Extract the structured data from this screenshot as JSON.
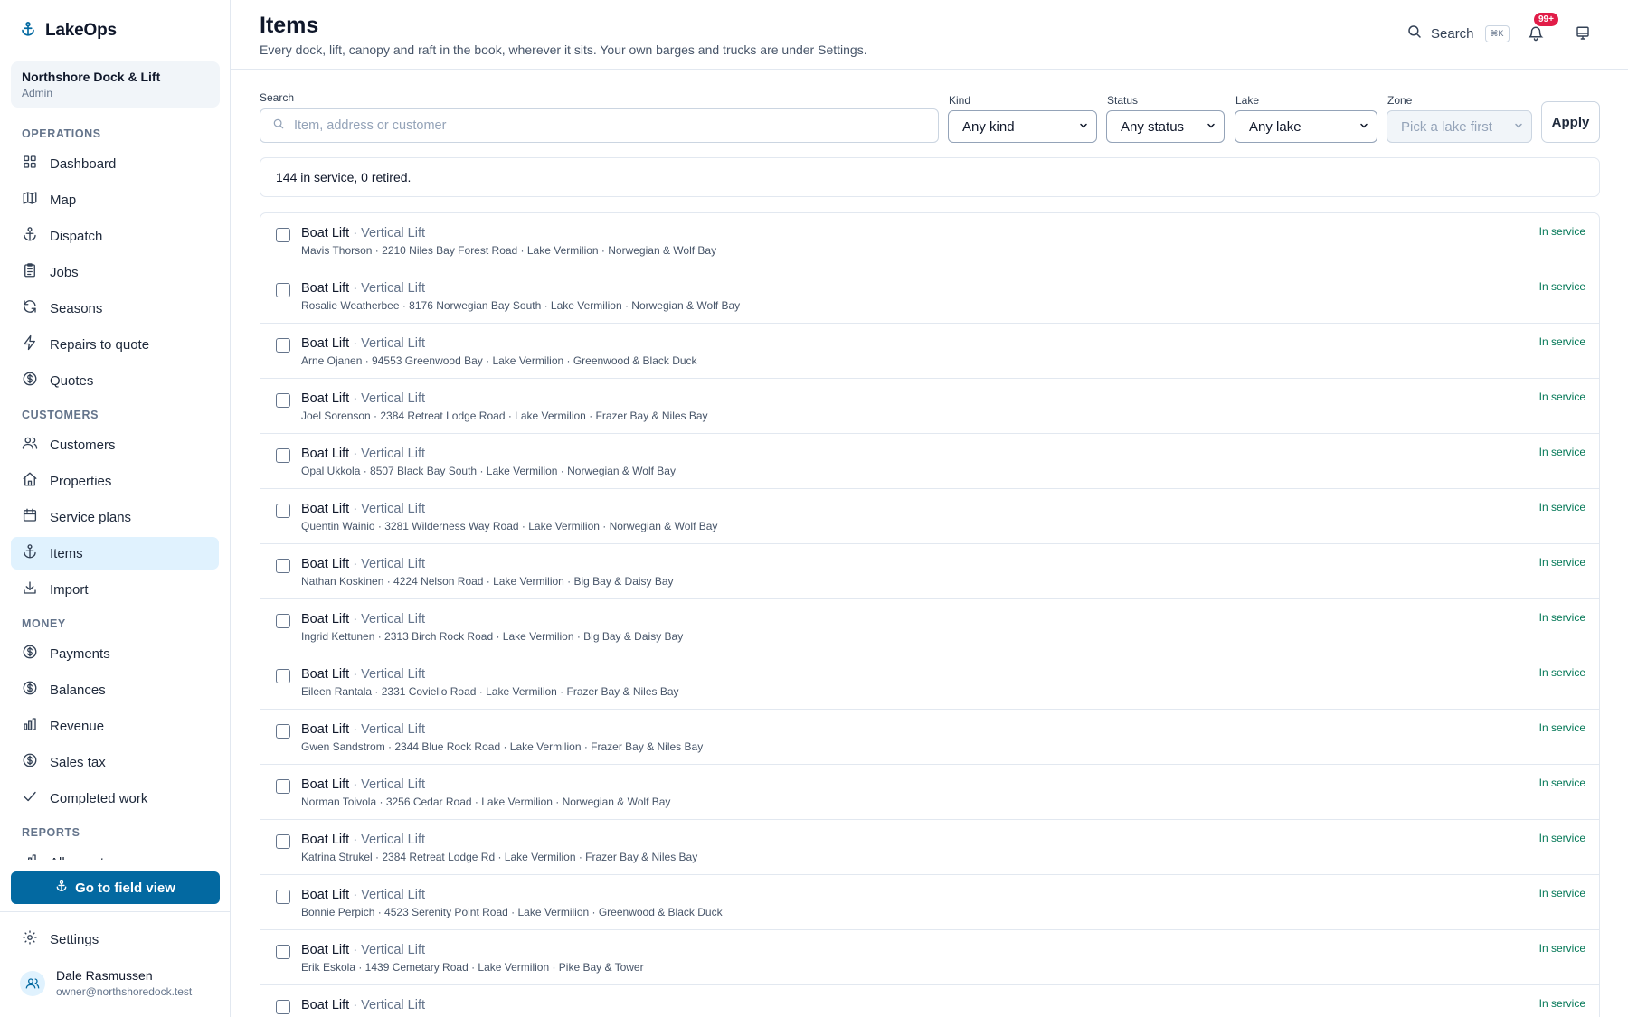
{
  "app": {
    "name": "LakeOps"
  },
  "org": {
    "name": "Northshore Dock & Lift",
    "role": "Admin"
  },
  "nav": {
    "sections": [
      {
        "label": "OPERATIONS",
        "items": [
          {
            "label": "Dashboard",
            "icon": "grid-icon"
          },
          {
            "label": "Map",
            "icon": "map-icon"
          },
          {
            "label": "Dispatch",
            "icon": "anchor-icon"
          },
          {
            "label": "Jobs",
            "icon": "clipboard-icon"
          },
          {
            "label": "Seasons",
            "icon": "refresh-icon"
          },
          {
            "label": "Repairs to quote",
            "icon": "bolt-icon"
          },
          {
            "label": "Quotes",
            "icon": "dollar-circle-icon"
          }
        ]
      },
      {
        "label": "CUSTOMERS",
        "items": [
          {
            "label": "Customers",
            "icon": "users-icon"
          },
          {
            "label": "Properties",
            "icon": "home-icon"
          },
          {
            "label": "Service plans",
            "icon": "calendar-icon"
          },
          {
            "label": "Items",
            "icon": "anchor-icon",
            "active": true
          },
          {
            "label": "Import",
            "icon": "download-icon"
          }
        ]
      },
      {
        "label": "MONEY",
        "items": [
          {
            "label": "Payments",
            "icon": "dollar-circle-icon"
          },
          {
            "label": "Balances",
            "icon": "dollar-circle-icon"
          },
          {
            "label": "Revenue",
            "icon": "bar-chart-icon"
          },
          {
            "label": "Sales tax",
            "icon": "dollar-circle-icon"
          },
          {
            "label": "Completed work",
            "icon": "check-icon"
          }
        ]
      },
      {
        "label": "REPORTS",
        "items": [
          {
            "label": "All reports",
            "icon": "bar-chart-icon"
          }
        ]
      }
    ],
    "field_view": "Go to field view",
    "settings": "Settings"
  },
  "user": {
    "name": "Dale Rasmussen",
    "email": "owner@northshoredock.test"
  },
  "header": {
    "title": "Items",
    "subtitle": "Every dock, lift, canopy and raft in the book, wherever it sits. Your own barges and trucks are under Settings.",
    "search_label": "Search",
    "search_shortcut": "⌘K",
    "notifications_badge": "99+"
  },
  "filters": {
    "search_label": "Search",
    "search_placeholder": "Item, address or customer",
    "kind_label": "Kind",
    "kind_value": "Any kind",
    "status_label": "Status",
    "status_value": "Any status",
    "lake_label": "Lake",
    "lake_value": "Any lake",
    "zone_label": "Zone",
    "zone_value": "Pick a lake first",
    "apply": "Apply"
  },
  "summary": "144 in service, 0 retired.",
  "items": [
    {
      "name": "Boat Lift",
      "kind": "Vertical Lift",
      "detail": "Mavis Thorson · 2210 Niles Bay Forest Road · Lake Vermilion · Norwegian & Wolf Bay",
      "status": "In service"
    },
    {
      "name": "Boat Lift",
      "kind": "Vertical Lift",
      "detail": "Rosalie Weatherbee · 8176 Norwegian Bay South · Lake Vermilion · Norwegian & Wolf Bay",
      "status": "In service"
    },
    {
      "name": "Boat Lift",
      "kind": "Vertical Lift",
      "detail": "Arne Ojanen · 94553 Greenwood Bay · Lake Vermilion · Greenwood & Black Duck",
      "status": "In service"
    },
    {
      "name": "Boat Lift",
      "kind": "Vertical Lift",
      "detail": "Joel Sorenson · 2384 Retreat Lodge Road · Lake Vermilion · Frazer Bay & Niles Bay",
      "status": "In service"
    },
    {
      "name": "Boat Lift",
      "kind": "Vertical Lift",
      "detail": "Opal Ukkola · 8507 Black Bay South · Lake Vermilion · Norwegian & Wolf Bay",
      "status": "In service"
    },
    {
      "name": "Boat Lift",
      "kind": "Vertical Lift",
      "detail": "Quentin Wainio · 3281 Wilderness Way Road · Lake Vermilion · Norwegian & Wolf Bay",
      "status": "In service"
    },
    {
      "name": "Boat Lift",
      "kind": "Vertical Lift",
      "detail": "Nathan Koskinen · 4224 Nelson Road · Lake Vermilion · Big Bay & Daisy Bay",
      "status": "In service"
    },
    {
      "name": "Boat Lift",
      "kind": "Vertical Lift",
      "detail": "Ingrid Kettunen · 2313 Birch Rock Road · Lake Vermilion · Big Bay & Daisy Bay",
      "status": "In service"
    },
    {
      "name": "Boat Lift",
      "kind": "Vertical Lift",
      "detail": "Eileen Rantala · 2331 Coviello Road · Lake Vermilion · Frazer Bay & Niles Bay",
      "status": "In service"
    },
    {
      "name": "Boat Lift",
      "kind": "Vertical Lift",
      "detail": "Gwen Sandstrom · 2344 Blue Rock Road · Lake Vermilion · Frazer Bay & Niles Bay",
      "status": "In service"
    },
    {
      "name": "Boat Lift",
      "kind": "Vertical Lift",
      "detail": "Norman Toivola · 3256 Cedar Road · Lake Vermilion · Norwegian & Wolf Bay",
      "status": "In service"
    },
    {
      "name": "Boat Lift",
      "kind": "Vertical Lift",
      "detail": "Katrina Strukel · 2384 Retreat Lodge Rd · Lake Vermilion · Frazer Bay & Niles Bay",
      "status": "In service"
    },
    {
      "name": "Boat Lift",
      "kind": "Vertical Lift",
      "detail": "Bonnie Perpich · 4523 Serenity Point Road · Lake Vermilion · Greenwood & Black Duck",
      "status": "In service"
    },
    {
      "name": "Boat Lift",
      "kind": "Vertical Lift",
      "detail": "Erik Eskola · 1439 Cemetary Road · Lake Vermilion · Pike Bay & Tower",
      "status": "In service"
    },
    {
      "name": "Boat Lift",
      "kind": "Vertical Lift",
      "detail": "",
      "status": "In service"
    }
  ],
  "colors": {
    "accent": "#0369a1",
    "status_green": "#047857",
    "badge": "#e11d48"
  }
}
